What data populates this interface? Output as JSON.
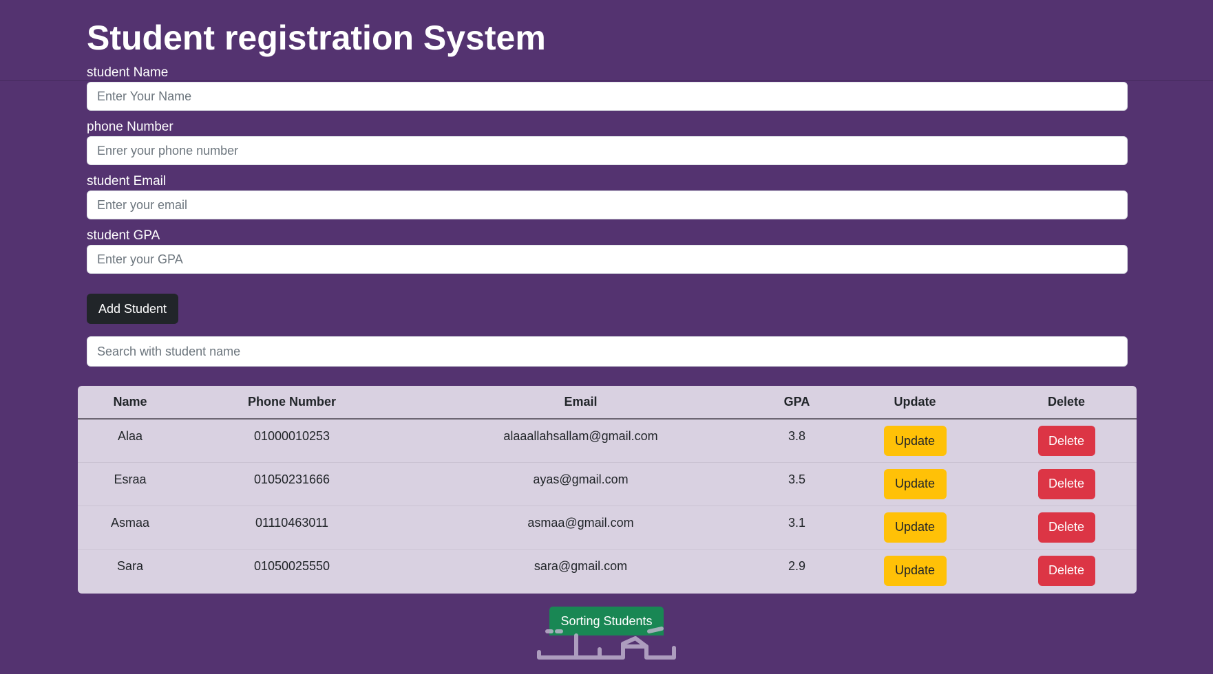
{
  "app": {
    "title": "Student registration System"
  },
  "form": {
    "name_label": "student Name",
    "name_placeholder": "Enter Your Name",
    "phone_label": "phone Number",
    "phone_placeholder": "Enrer your phone number",
    "email_label": "student Email",
    "email_placeholder": "Enter your email",
    "gpa_label": "student GPA",
    "gpa_placeholder": "Enter your GPA",
    "add_button": "Add Student"
  },
  "search": {
    "placeholder": "Search with student name"
  },
  "table": {
    "headers": [
      "Name",
      "Phone Number",
      "Email",
      "GPA",
      "Update",
      "Delete"
    ],
    "rows": [
      {
        "name": "Alaa",
        "phone": "01000010253",
        "email": "alaaallahsallam@gmail.com",
        "gpa": "3.8",
        "update": "Update",
        "delete": "Delete"
      },
      {
        "name": "Esraa",
        "phone": "01050231666",
        "email": "ayas@gmail.com",
        "gpa": "3.5",
        "update": "Update",
        "delete": "Delete"
      },
      {
        "name": "Asmaa",
        "phone": "01110463011",
        "email": "asmaa@gmail.com",
        "gpa": "3.1",
        "update": "Update",
        "delete": "Delete"
      },
      {
        "name": "Sara",
        "phone": "01050025550",
        "email": "sara@gmail.com",
        "gpa": "2.9",
        "update": "Update",
        "delete": "Delete"
      }
    ]
  },
  "actions": {
    "sort_button": "Sorting Students"
  },
  "watermark": {
    "text": "خمسات"
  },
  "colors": {
    "background": "#543370",
    "add_button": "#212529",
    "update_button": "#ffc107",
    "delete_button": "#dc3545",
    "sort_button": "#198754",
    "table_background": "#d9d1e1"
  }
}
